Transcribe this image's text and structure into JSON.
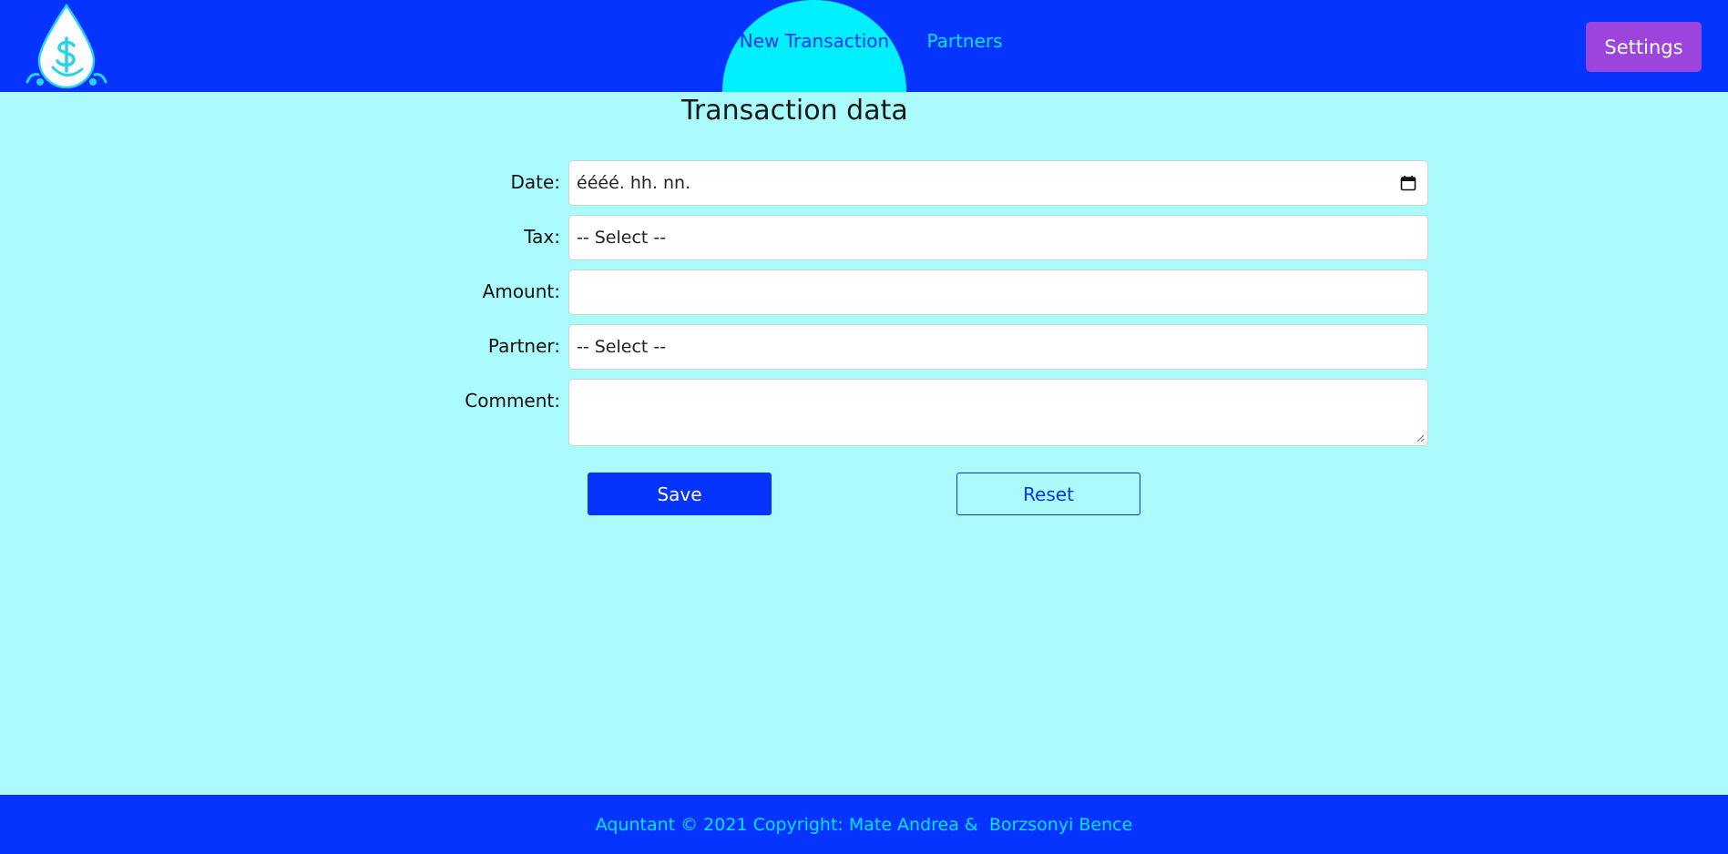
{
  "nav": {
    "logo_icon": "water-drop-dollar-icon",
    "tabs": [
      {
        "label": "New Transaction",
        "active": true
      },
      {
        "label": "Partners",
        "active": false
      }
    ],
    "settings_label": "Settings"
  },
  "form": {
    "title": "Transaction data",
    "fields": {
      "date": {
        "label": "Date:",
        "value": "éééé. hh. nn."
      },
      "tax": {
        "label": "Tax:",
        "value": "-- Select --"
      },
      "amount": {
        "label": "Amount:",
        "value": ""
      },
      "partner": {
        "label": "Partner:",
        "value": "-- Select --"
      },
      "comment": {
        "label": "Comment:",
        "value": ""
      }
    },
    "save_label": "Save",
    "reset_label": "Reset"
  },
  "footer": {
    "text": "Aquntant © 2021 Copyright: Mate Andrea &  Borzsonyi Bence"
  },
  "colors": {
    "primary": "#0533ff",
    "page_bg": "#aafbfc",
    "active_tab": "#00f0ff",
    "accent_text": "#00e5ff",
    "settings": "#9b45dc"
  }
}
